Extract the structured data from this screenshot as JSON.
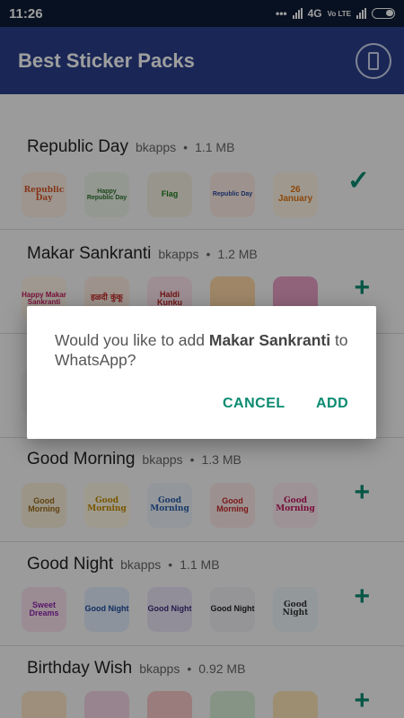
{
  "status_bar": {
    "time": "11:26",
    "network": "4G",
    "carrier": "Vo LTE"
  },
  "app_bar": {
    "title": "Best Sticker Packs",
    "action_icon": "phone-vibrate-icon"
  },
  "packs": [
    {
      "name": "Republic Day",
      "publisher": "bkapps",
      "size": "1.1 MB",
      "action": "added",
      "stickers": [
        "Republic Day",
        "Happy Republic Day",
        "Flag",
        "Republic Day",
        "26 January"
      ]
    },
    {
      "name": "Makar Sankranti",
      "publisher": "bkapps",
      "size": "1.2 MB",
      "action": "add",
      "stickers": [
        "Happy Makar Sankranti",
        "हळदी कुंकू",
        "Haldi Kunku",
        "",
        ""
      ]
    },
    {
      "name": "Good Morning",
      "publisher": "bkapps",
      "size": "1.3 MB",
      "action": "add",
      "stickers": [
        "Good Morning",
        "Good Morning",
        "Good Morning",
        "Good Morning",
        "Good Morning"
      ]
    },
    {
      "name": "Good Night",
      "publisher": "bkapps",
      "size": "1.1 MB",
      "action": "add",
      "stickers": [
        "Sweet Dreams",
        "Good Night",
        "Good Night",
        "Good Night",
        "Good Night"
      ]
    },
    {
      "name": "Birthday Wish",
      "publisher": "bkapps",
      "size": "0.92 MB",
      "action": "add",
      "stickers": [
        "",
        "",
        "",
        "",
        ""
      ]
    }
  ],
  "dialog": {
    "prefix": "Would you like to add ",
    "pack_name": "Makar Sankranti",
    "suffix": " to WhatsApp?",
    "cancel_label": "CANCEL",
    "add_label": "ADD"
  },
  "colors": {
    "status_bar": "#0d1c36",
    "app_bar": "#2b3f8c",
    "accent": "#0a8b71"
  }
}
